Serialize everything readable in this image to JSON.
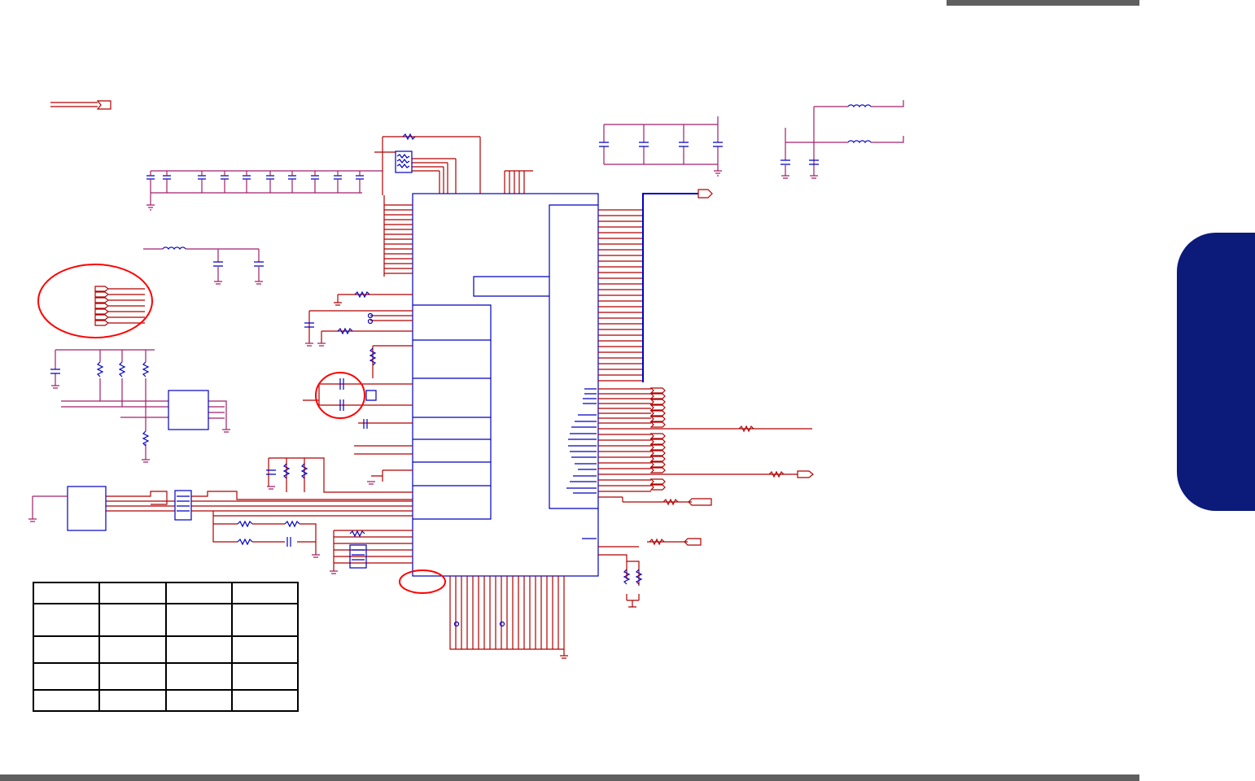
{
  "page": {
    "colors": {
      "wire_red": "#b00000",
      "wire_blue": "#0000c0",
      "net_magenta": "#a0206a",
      "highlight_red": "#ff0000",
      "tab_navy": "#0c1a7a",
      "bar_gray": "#5f5f5f"
    }
  },
  "table": {
    "rows": [
      [
        "",
        "",
        "",
        ""
      ],
      [
        "",
        "",
        "",
        ""
      ],
      [
        "",
        "",
        "",
        ""
      ],
      [
        "",
        "",
        "",
        ""
      ],
      [
        "",
        "",
        "",
        ""
      ]
    ]
  }
}
